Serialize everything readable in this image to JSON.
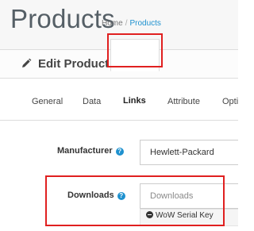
{
  "header": {
    "title": "Products",
    "breadcrumb": {
      "home": "Home",
      "separator": "/",
      "current": "Products"
    }
  },
  "panel": {
    "icon": "pencil-icon",
    "title": "Edit Product"
  },
  "tabs": [
    {
      "label": "General"
    },
    {
      "label": "Data"
    },
    {
      "label": "Links",
      "active": true
    },
    {
      "label": "Attribute"
    },
    {
      "label": "Opti"
    }
  ],
  "form": {
    "manufacturer": {
      "label": "Manufacturer",
      "value": "Hewlett-Packard",
      "help_icon": "question-circle-icon"
    },
    "downloads": {
      "label": "Downloads",
      "placeholder": "Downloads",
      "help_icon": "question-circle-icon",
      "items": [
        {
          "label": "WoW Serial Key",
          "icon": "minus-circle-icon"
        }
      ]
    }
  },
  "colors": {
    "accent_blue": "#1e91cf",
    "highlight_red": "#e02020",
    "header_bg": "#f7f7f7"
  }
}
